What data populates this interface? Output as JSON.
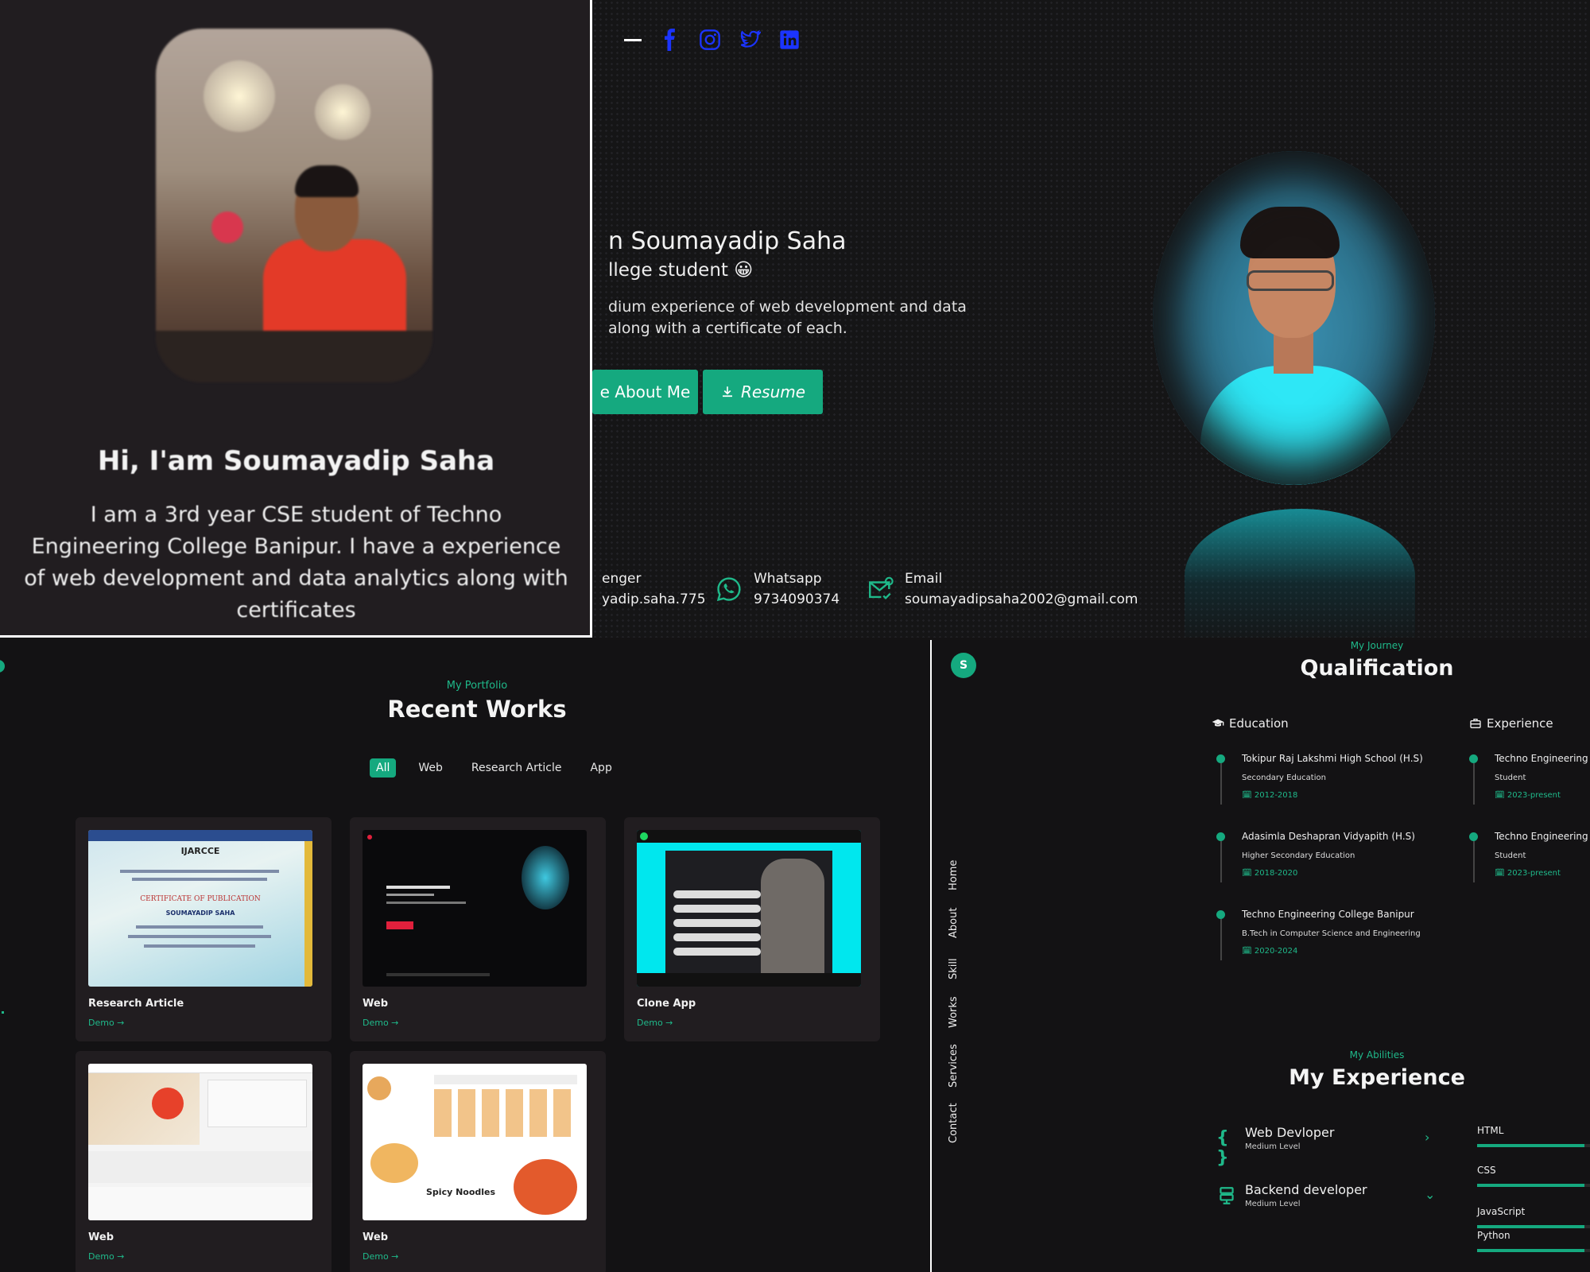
{
  "intro_card": {
    "title": "Hi, I'am Soumayadip Saha",
    "description": "I am a 3rd year CSE student of Techno Engineering College Banipur. I have a experience of web development and data analytics along with certificates"
  },
  "hero": {
    "name": "n Soumayadip Saha",
    "role": "llege student 😀",
    "description_line1": "dium experience of web development and data",
    "description_line2": "along with a certificate of each.",
    "more_button": "e About Me",
    "resume_button": "Resume",
    "social_icons": [
      "facebook-icon",
      "instagram-icon",
      "twitter-icon",
      "linkedin-icon"
    ],
    "contacts": [
      {
        "label": "enger",
        "value": "yadip.saha.775"
      },
      {
        "label": "Whatsapp",
        "value": "9734090374"
      },
      {
        "label": "Email",
        "value": "soumayadipsaha2002@gmail.com"
      }
    ]
  },
  "portfolio": {
    "subtitle": "My Portfolio",
    "title": "Recent Works",
    "filters": [
      "All",
      "Web",
      "Research Article",
      "App"
    ],
    "active_filter": "All",
    "cards": [
      {
        "title": "Research Article",
        "link": "Demo →",
        "cert_header": "IJARCCE",
        "cert_title": "CERTIFICATE OF PUBLICATION",
        "cert_name": "SOUMAYADIP SAHA"
      },
      {
        "title": "Web",
        "link": "Demo →"
      },
      {
        "title": "Clone App",
        "link": "Demo →"
      },
      {
        "title": "Web",
        "link": "Demo →"
      },
      {
        "title": "Web",
        "link": "Demo →",
        "thumb_text": "Spicy Noodles"
      }
    ]
  },
  "qualification": {
    "badge": "S",
    "nav": [
      "Home",
      "About",
      "Skill",
      "Works",
      "Services",
      "Contact"
    ],
    "subtitle": "My Journey",
    "title": "Qualification",
    "education_label": "Education",
    "experience_label": "Experience",
    "education": [
      {
        "school": "Tokipur Raj Lakshmi High School (H.S)",
        "level": "Secondary Education",
        "years": "2012-2018"
      },
      {
        "school": "Adasimla Deshapran Vidyapith (H.S)",
        "level": "Higher Secondary Education",
        "years": "2018-2020"
      },
      {
        "school": "Techno Engineering College Banipur",
        "level": "B.Tech in Computer Science and Engineering",
        "years": "2020-2024"
      }
    ],
    "experience": [
      {
        "place": "Techno Engineering",
        "role": "Student",
        "years": "2023-present"
      },
      {
        "place": "Techno Engineering",
        "role": "Student",
        "years": "2023-present"
      }
    ]
  },
  "abilities": {
    "subtitle": "My Abilities",
    "title": "My Experience",
    "categories": [
      {
        "name": "Web Devloper",
        "level": "Medium Level",
        "icon": "code-braces-icon",
        "chevron": "›"
      },
      {
        "name": "Backend developer",
        "level": "Medium Level",
        "icon": "server-icon",
        "chevron": "⌄"
      }
    ],
    "skills": [
      {
        "name": "HTML",
        "percent": 90
      },
      {
        "name": "CSS",
        "percent": 90
      },
      {
        "name": "JavaScript",
        "percent": 90
      },
      {
        "name": "Python",
        "percent": 90
      }
    ]
  },
  "colors": {
    "accent": "#15a97f",
    "social": "#1b34ff",
    "panel": "#211d20",
    "background": "#131214"
  }
}
